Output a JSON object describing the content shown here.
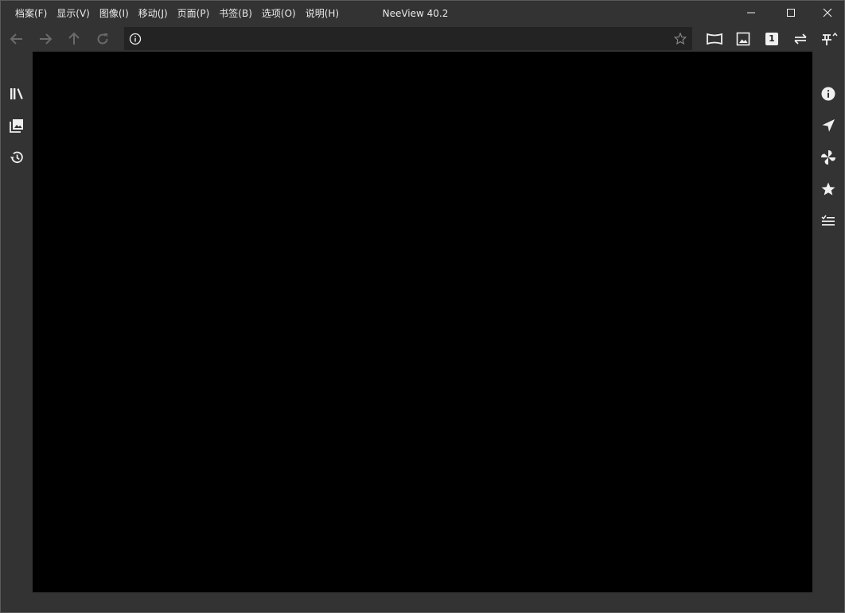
{
  "window": {
    "title": "NeeView 40.2"
  },
  "menu": {
    "items": [
      "档案(F)",
      "显示(V)",
      "图像(I)",
      "移动(J)",
      "页面(P)",
      "书签(B)",
      "选项(O)",
      "说明(H)"
    ]
  },
  "address_bar": {
    "value": "",
    "placeholder": ""
  },
  "toolbar": {
    "single_page_label": "1"
  },
  "theme": {
    "chrome_color": "#333333",
    "viewer_background": "#000000",
    "icon_color": "#f0f0f0",
    "icon_disabled_color": "#6a6a6a"
  }
}
